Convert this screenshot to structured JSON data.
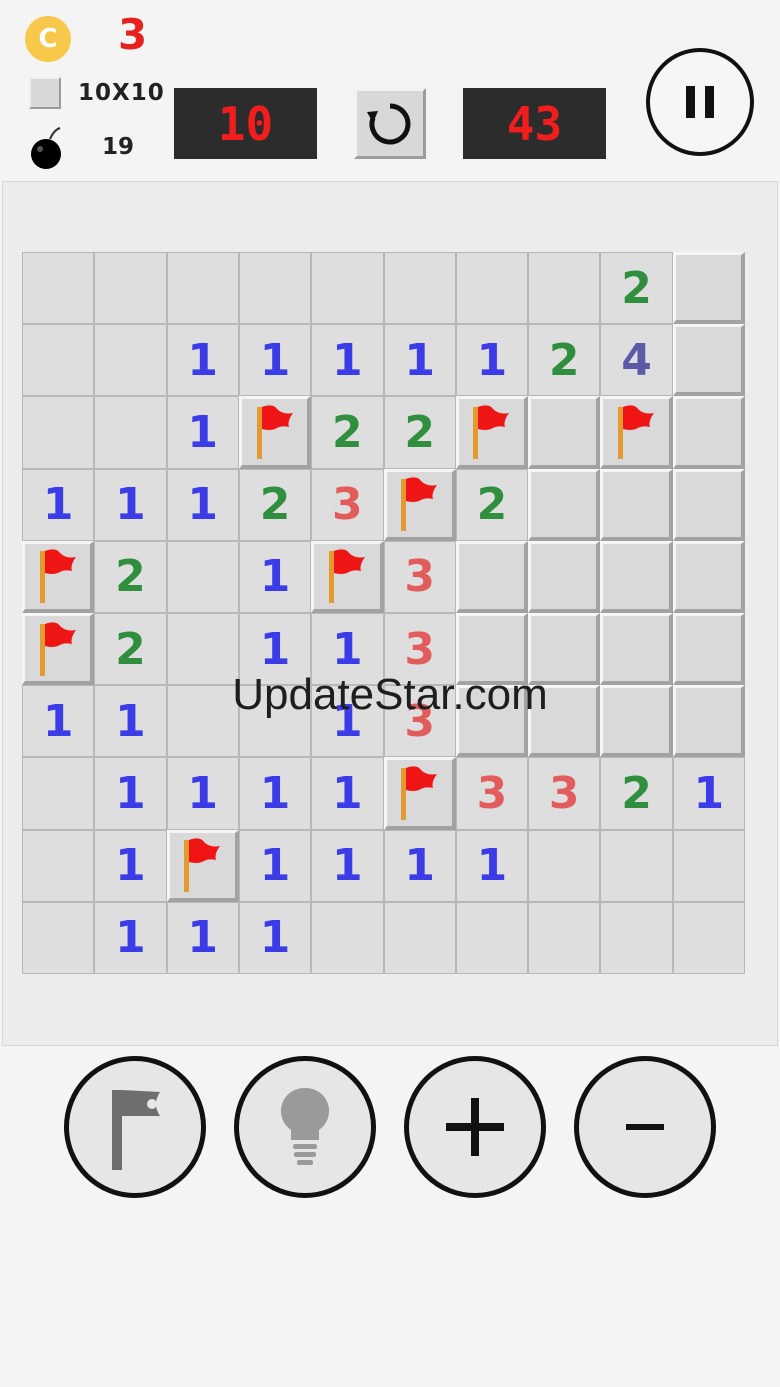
{
  "header": {
    "coin_symbol": "C",
    "coin_count": "3",
    "board_size": "10X10",
    "mine_total": "19",
    "mines_remaining": "10",
    "time": "43"
  },
  "board": [
    [
      "",
      "",
      "",
      "",
      "",
      "",
      "",
      "",
      "2",
      "#"
    ],
    [
      "",
      "",
      "1",
      "1",
      "1",
      "1",
      "1",
      "2",
      "4",
      "#"
    ],
    [
      "",
      "",
      "1",
      "F",
      "2",
      "2",
      "F",
      "#",
      "F",
      "#"
    ],
    [
      "1",
      "1",
      "1",
      "2",
      "3",
      "F",
      "2",
      "#",
      "#",
      "#"
    ],
    [
      "F",
      "2",
      "",
      "1",
      "F",
      "3",
      "#",
      "#",
      "#",
      "#"
    ],
    [
      "F",
      "2",
      "",
      "1",
      "1",
      "3",
      "#",
      "#",
      "#",
      "#"
    ],
    [
      "1",
      "1",
      "",
      "",
      "1",
      "3",
      "#",
      "#",
      "#",
      "#"
    ],
    [
      "",
      "1",
      "1",
      "1",
      "1",
      "F",
      "3",
      "3",
      "2",
      "1"
    ],
    [
      "",
      "1",
      "F",
      "1",
      "1",
      "1",
      "1",
      "",
      "",
      ""
    ],
    [
      "",
      "1",
      "1",
      "1",
      "",
      "",
      "",
      "",
      "",
      ""
    ]
  ],
  "number_colors": {
    "1": "#3b3be8",
    "2": "#2f8f3e",
    "3": "#e25c5c",
    "4": "#5a5aa6"
  },
  "watermark": "UpdateStar.com",
  "toolbar": {
    "flag": "flag-icon",
    "hint": "lightbulb-icon",
    "zoom_in": "plus-icon",
    "zoom_out": "minus-icon"
  }
}
